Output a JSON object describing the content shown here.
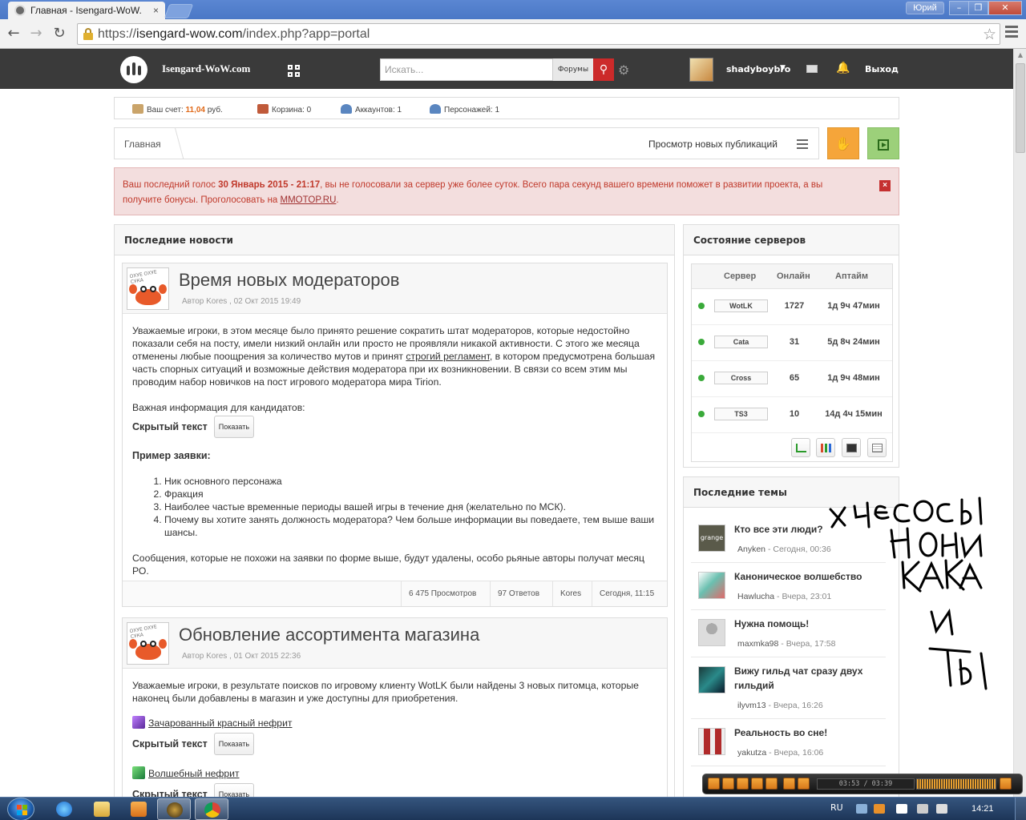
{
  "browser": {
    "tab_title": "Главная - Isengard-WoW.",
    "tab_close": "×",
    "window_user": "Юрий",
    "url_scheme": "https://",
    "url_host": "isengard-wow.com",
    "url_path": "/index.php?app=portal",
    "btn_min": "–",
    "btn_max": "❐",
    "btn_close": "✕"
  },
  "site_header": {
    "site_name": "Isengard-WoW.com",
    "search_placeholder": "Искать...",
    "search_scope": "Форумы",
    "username": "shadyboybro",
    "logout": "Выход"
  },
  "account_bar": {
    "balance_label": "Ваш счет:",
    "balance_value": "11,04",
    "balance_unit": "руб.",
    "cart": "Корзина: 0",
    "accounts": "Аккаунтов: 1",
    "characters": "Персонажей: 1"
  },
  "breadcrumb": {
    "home": "Главная",
    "new_publications": "Просмотр новых публикаций"
  },
  "vote_alert": {
    "text1": "Ваш последний голос ",
    "date": "30 Январь 2015 - 21:17",
    "text2": ", вы не голосовали за сервер уже более суток. Всего пара секунд вашего времени поможет в развитии проекта, а вы получите бонусы. Проголосовать на ",
    "link": "MMOTOP.RU",
    "text3": ".",
    "close": "×"
  },
  "news": {
    "header": "Последние новости",
    "posts": [
      {
        "avatar_text": "ОХУЕ ОХУЕ СУКА",
        "title": "Время новых модераторов",
        "meta": "Автор  Kores , 02 Окт 2015 19:49",
        "para1_a": "Уважаемые игроки, в этом месяце было принято решение сократить штат модераторов, которые недостойно показали себя на посту, имели низкий онлайн или просто не проявляли никакой активности. С этого же месяца отменены любые поощрения за количество мутов и принят ",
        "para1_link": "строгий регламент",
        "para1_b": ", в котором предусмотрена большая часть спорных ситуаций и возможные действия модератора при их возникновении. В связи со всем этим мы проводим набор новичков на пост игрового модератора мира Tirion.",
        "para2": "Важная информация для кандидатов:",
        "hidden_label": "Скрытый текст",
        "show_button": "Показать",
        "example_heading": "Пример заявки:",
        "list": [
          "Ник основного персонажа",
          "Фракция",
          "Наиболее частые временные периоды вашей игры в течение дня (желательно по МСК).",
          "Почему вы хотите занять должность модератора? Чем больше информации вы поведаете, тем выше ваши шансы."
        ],
        "para3": "Сообщения, которые не похожи на заявки по форме выше, будут удалены, особо рьяные авторы получат месяц РО.",
        "stats": {
          "views": "6 475 Просмотров",
          "replies": "97 Ответов",
          "author": "Kores",
          "last": "Сегодня, 11:15"
        }
      },
      {
        "avatar_text": "ОХУЕ ОХУЕ СУКА",
        "title": "Обновление ассортимента магазина",
        "meta": "Автор  Kores , 01 Окт 2015 22:36",
        "para1": "Уважаемые игроки, в результате поисков по игровому клиенту WotLK были найдены 3 новых питомца, которые наконец были добавлены в магазин и уже доступны для приобретения.",
        "item1": "Зачарованный красный нефрит",
        "item2": "Волшебный нефрит",
        "hidden_label": "Скрытый текст",
        "show_button": "Показать"
      }
    ]
  },
  "servers": {
    "header": "Состояние серверов",
    "columns": [
      "Сервер",
      "Онлайн",
      "Аптайм"
    ],
    "rows": [
      {
        "name": "WotLK",
        "online": "1727",
        "uptime": "1д 9ч 47мин"
      },
      {
        "name": "Cata",
        "online": "31",
        "uptime": "5д 8ч 24мин"
      },
      {
        "name": "Cross",
        "online": "65",
        "uptime": "1д 9ч 48мин"
      },
      {
        "name": "TS3",
        "online": "10",
        "uptime": "14д 4ч 15мин"
      }
    ],
    "status_color": "#3aaa3a"
  },
  "topics": {
    "header": "Последние темы",
    "items": [
      {
        "title": "Кто все эти люди?",
        "author": "Anyken",
        "time": " - Сегодня, 00:36",
        "thumb_text": "grange"
      },
      {
        "title": "Каноническое волшебство",
        "author": "Hawlucha",
        "time": " - Вчера, 23:01",
        "thumb_text": ""
      },
      {
        "title": "Нужна помощь!",
        "author": "maxmka98",
        "time": " - Вчера, 17:58",
        "thumb_text": ""
      },
      {
        "title": "Вижу гильд чат сразу двух гильдий",
        "author": "ilyvm13",
        "time": " - Вчера, 16:26",
        "thumb_text": ""
      },
      {
        "title": "Реальность во сне!",
        "author": "yakutza",
        "time": " - Вчера, 16:06",
        "thumb_text": ""
      }
    ]
  },
  "player": {
    "time": "03:53 / 03:39"
  },
  "taskbar": {
    "lang": "RU",
    "clock": "14:21"
  },
  "colors": {
    "header_bg": "#3a3a3a",
    "accent_orange": "#e06a1a",
    "alert_red": "#c0392b",
    "search_red": "#cc2a2a"
  }
}
